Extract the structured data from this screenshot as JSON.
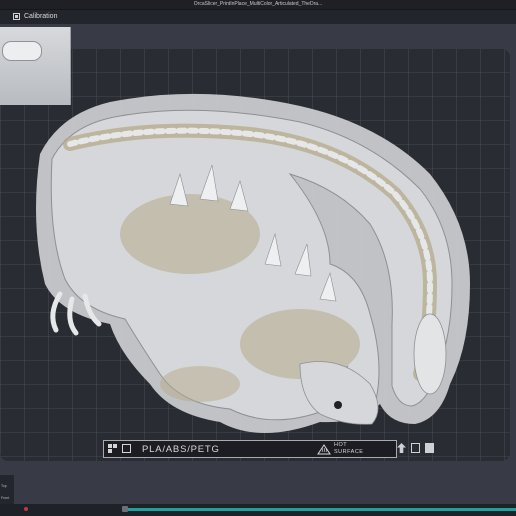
{
  "window": {
    "title": "OrcaSlicer_PrintInPlace_MultiColor_Articulated_TheDra..."
  },
  "tab": {
    "label": "Calibration",
    "icon": "calibration-icon"
  },
  "plate": {
    "material_text": "PLA/ABS/PETG",
    "hot_line1": "HOT",
    "hot_line2": "SURFACE",
    "warning_icon": "hot-surface-warning-icon"
  },
  "left_tools": {
    "item1": "Top",
    "item2": "Front"
  },
  "colors": {
    "plate": "#1d1f24",
    "grid": "#5b5d66",
    "model_light": "#d8d9dc",
    "model_accent": "#b5a98a",
    "timeline": "#19a39a"
  }
}
